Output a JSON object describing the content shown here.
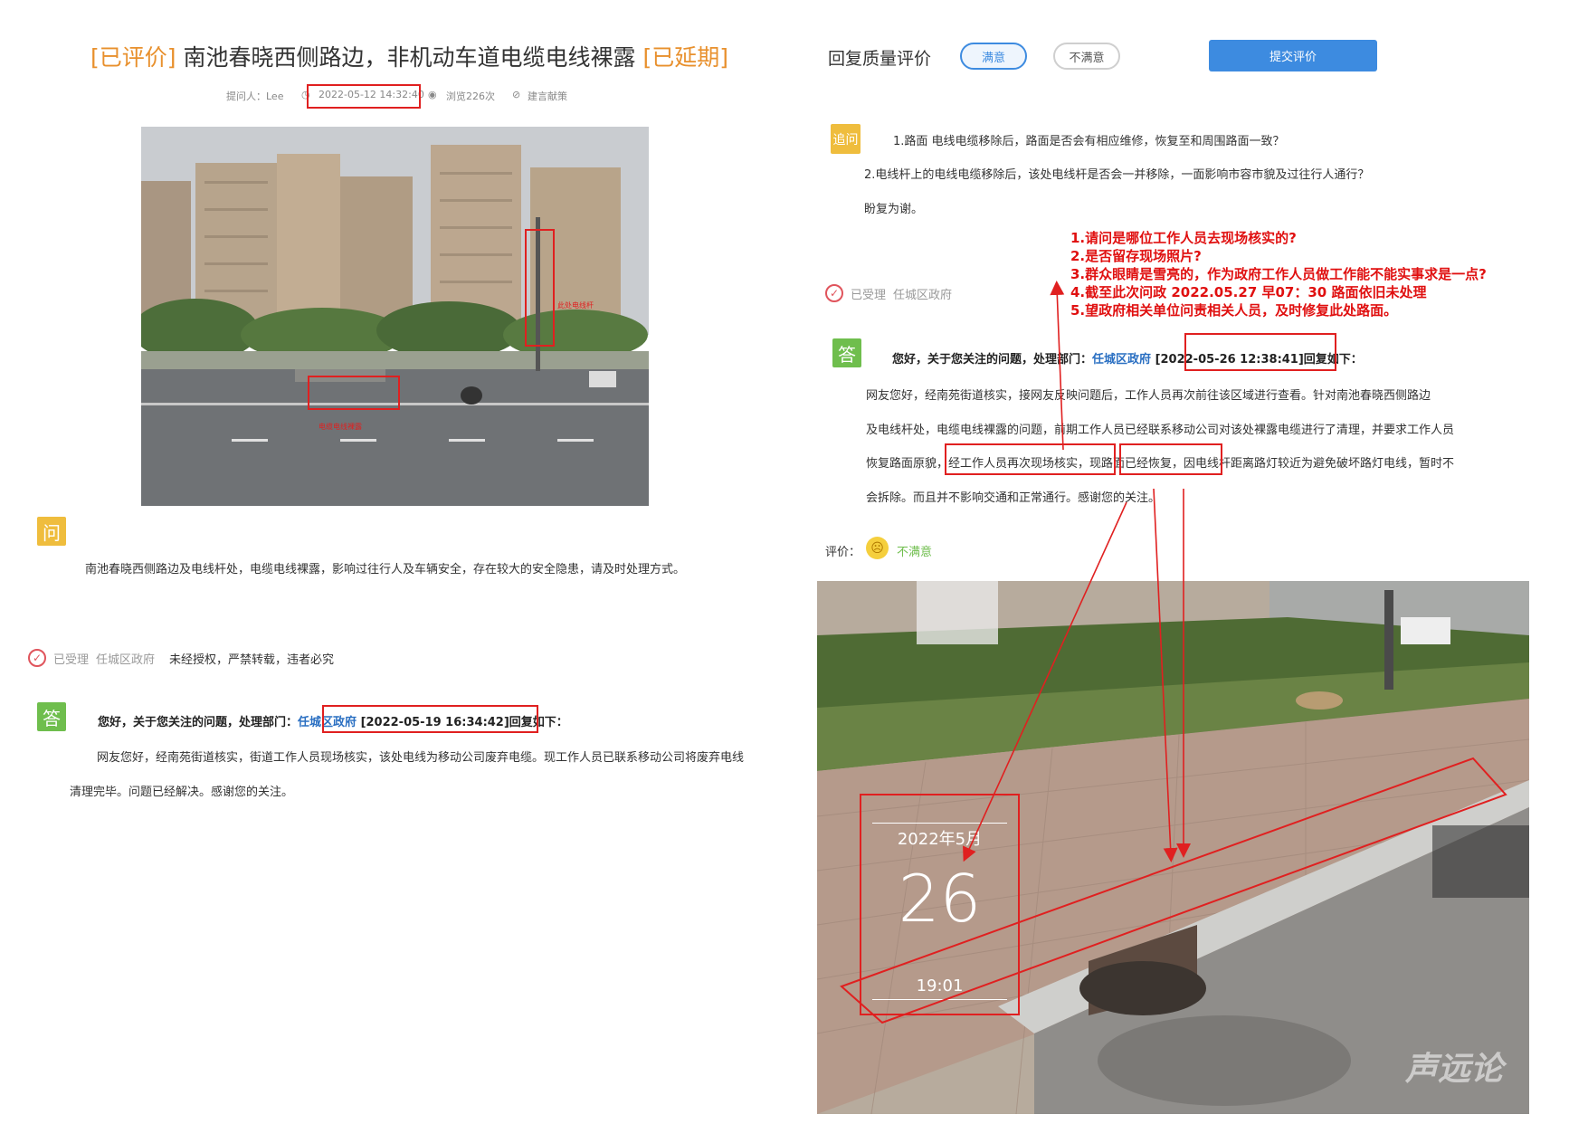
{
  "left": {
    "title_tag_1": "[已评价]",
    "title_text": "南池春晓西侧路边，非机动车道电缆电线裸露",
    "title_tag_2": "[已延期]",
    "asker": "提问人：Lee",
    "datetime": "2022-05-12 14:32:40",
    "views": "浏览226次",
    "category": "建言献策",
    "photo_label_pole": "此处电线杆",
    "photo_label_ground": "电缆电线裸露",
    "question_badge": "问",
    "question_text": "南池春晓西侧路边及电线杆处，电缆电线裸露，影响过往行人及车辆安全，存在较大的安全隐患，请及时处理方式。",
    "status_accepted": "已受理",
    "status_dept": "任城区政府",
    "status_notice": "未经授权，严禁转载，违者必究",
    "answer_badge": "答",
    "answer_intro": "您好，关于您关注的问题，处理部门：",
    "answer_dept": "任城区政府",
    "answer_time": "[2022-05-19 16:34:42]",
    "answer_suffix": "回复如下：",
    "answer_text": "网友您好，经南苑街道核实，街道工作人员现场核实，该处电线为移动公司废弃电缆。现工作人员已联系移动公司将废弃电线清理完毕。问题已经解决。感谢您的关注。"
  },
  "right": {
    "rating_title": "回复质量评价",
    "btn_satisfied": "满意",
    "btn_unsatisfied": "不满意",
    "btn_submit": "提交评价",
    "followup_badge": "追问",
    "followup_line1": "1.路面 电线电缆移除后，路面是否会有相应维修，恢复至和周围路面一致？",
    "followup_line2": "2.电线杆上的电线电缆移除后，该处电线杆是否会一并移除，一面影响市容市貌及过往行人通行？",
    "followup_line3": "盼复为谢。",
    "status_accepted": "已受理",
    "status_dept": "任城区政府",
    "annotations": [
      "1.请问是哪位工作人员去现场核实的?",
      "2.是否留存现场照片?",
      "3.群众眼睛是雪亮的，作为政府工作人员做工作能不能实事求是一点?",
      "4.截至此次问政 2022.05.27 早07：30 路面依旧未处理",
      "5.望政府相关单位问责相关人员，及时修复此处路面。"
    ],
    "answer_badge": "答",
    "answer_intro": "您好，关于您关注的问题，处理部门：",
    "answer_dept": "任城区政府",
    "answer_time": "[2022-05-26 12:38:41]",
    "answer_suffix": "回复如下：",
    "answer_line1": "网友您好，经南苑街道核实，接网友反映问题后，工作人员再次前往该区域进行查看。针对南池春晓西侧路边",
    "answer_line2": "及电线杆处，电缆电线裸露的问题，前期工作人员已经联系移动公司对该处裸露电缆进行了清理，并要求工作人员",
    "answer_line3_a": "恢复路面原貌，",
    "answer_line3_b": "经工作人员再次现场核实，",
    "answer_line3_c": "现路面已经恢复，",
    "answer_line3_d": "因电线杆距离路灯较近为避免破坏路灯电线，暂时不",
    "answer_line4": "会拆除。而且并不影响交通和正常通行。感谢您的关注。",
    "rating_label": "评价：",
    "rating_value": "不满意",
    "photo_date": "2022年5月",
    "photo_day": "26",
    "photo_time": "19:01",
    "watermark": "声远论"
  }
}
